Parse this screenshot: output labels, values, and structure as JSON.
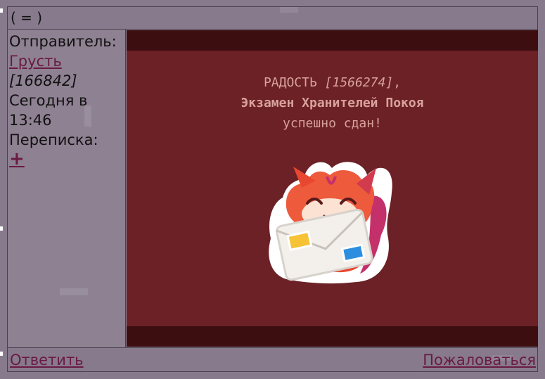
{
  "header": {
    "title": "( = )"
  },
  "sidebar": {
    "sender_label": "Отправитель:",
    "sender_name": "Грусть",
    "sender_id": "[166842]",
    "date_line1": "Сегодня в",
    "date_line2": "13:46",
    "thread_label": "Переписка:",
    "add_label": "+"
  },
  "message": {
    "recipient_name": "РАДОСТЬ",
    "recipient_id": "[1566274]",
    "recipient_suffix": ",",
    "exam_name": "Экзамен Хранителей Покоя",
    "result_text": "успешно сдан!",
    "sticker_icon": "fox-with-letter-sticker"
  },
  "footer": {
    "reply_label": "Ответить",
    "report_label": "Пожаловаться"
  },
  "colors": {
    "page_background": "#877a8c",
    "message_background": "#6b2126",
    "message_band": "#3d0e0f",
    "message_text": "#d9a29c",
    "link": "#6a1a44"
  }
}
